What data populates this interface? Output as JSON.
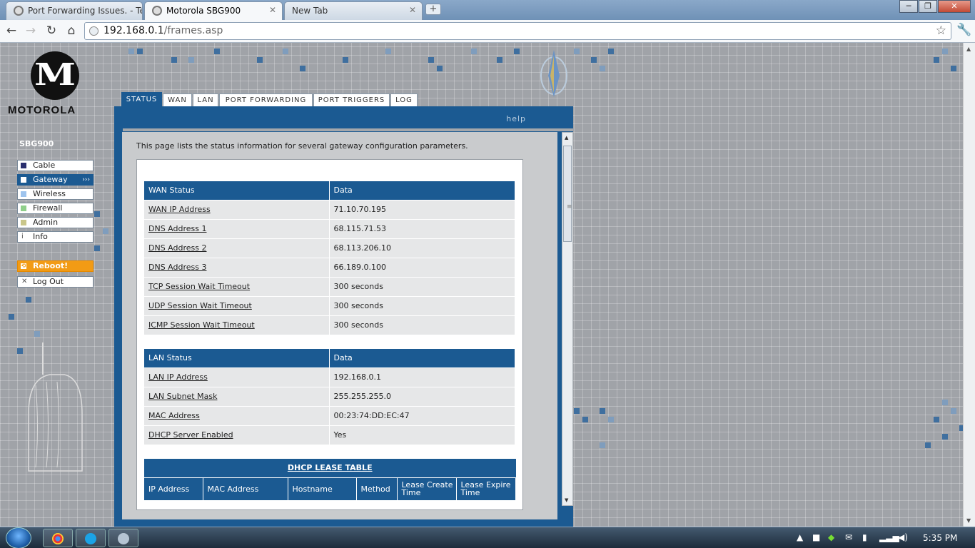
{
  "browser": {
    "tabs": [
      {
        "label": "Port Forwarding Issues. - Te"
      },
      {
        "label": "Motorola SBG900"
      },
      {
        "label": "New Tab"
      }
    ],
    "new_tab_glyph": "+",
    "window_controls": {
      "minimize": "─",
      "restore": "❐",
      "close": "✕"
    },
    "address": {
      "host": "192.168.0.1",
      "path": "/frames.asp"
    },
    "nav": {
      "back": "←",
      "forward": "→",
      "reload": "↻",
      "home": "⌂",
      "star": "☆",
      "wrench": "🔧"
    }
  },
  "brand": {
    "logo_letter": "M",
    "name": "MOTOROLA",
    "model": "SBG900"
  },
  "sidebar": {
    "items": [
      {
        "label": "Cable",
        "color": "#2a2f6e"
      },
      {
        "label": "Gateway",
        "color": "#ffffff",
        "arrow": "›››"
      },
      {
        "label": "Wireless",
        "color": "#9ec4ee"
      },
      {
        "label": "Firewall",
        "color": "#8fcf8a"
      },
      {
        "label": "Admin",
        "color": "#c9c68a"
      },
      {
        "label": "Info",
        "glyph": "i"
      }
    ],
    "reboot": {
      "label": "Reboot!",
      "glyph": "⟲"
    },
    "logout": {
      "label": "Log Out",
      "glyph": "✕"
    }
  },
  "tabs": [
    {
      "label": "STATUS"
    },
    {
      "label": "WAN"
    },
    {
      "label": "LAN"
    },
    {
      "label": "PORT FORWARDING"
    },
    {
      "label": "PORT TRIGGERS"
    },
    {
      "label": "LOG"
    }
  ],
  "help": "help",
  "intro": "This page lists the status information for several gateway configuration parameters.",
  "wan": {
    "headers": [
      "WAN Status",
      "Data"
    ],
    "rows": [
      {
        "label": "WAN IP Address",
        "value": "71.10.70.195"
      },
      {
        "label": "DNS Address 1",
        "value": "68.115.71.53"
      },
      {
        "label": "DNS Address 2",
        "value": "68.113.206.10"
      },
      {
        "label": "DNS Address 3",
        "value": "66.189.0.100"
      },
      {
        "label": "TCP Session Wait Timeout",
        "value": "300 seconds"
      },
      {
        "label": "UDP Session Wait Timeout",
        "value": "300 seconds"
      },
      {
        "label": "ICMP Session Wait Timeout",
        "value": "300 seconds"
      }
    ]
  },
  "lan": {
    "headers": [
      "LAN Status",
      "Data"
    ],
    "rows": [
      {
        "label": "LAN IP Address",
        "value": "192.168.0.1"
      },
      {
        "label": "LAN Subnet Mask",
        "value": "255.255.255.0"
      },
      {
        "label": "MAC Address",
        "value": "00:23:74:DD:EC:47"
      },
      {
        "label": "DHCP Server Enabled",
        "value": "Yes"
      }
    ]
  },
  "lease": {
    "title": "DHCP LEASE TABLE",
    "columns": [
      "IP Address",
      "MAC Address",
      "Hostname",
      "Method",
      "Lease Create Time",
      "Lease Expire Time"
    ]
  },
  "taskbar": {
    "clock": "5:35 PM"
  },
  "colors": {
    "panel_blue": "#1b5a92",
    "reboot_orange": "#f29b15"
  }
}
